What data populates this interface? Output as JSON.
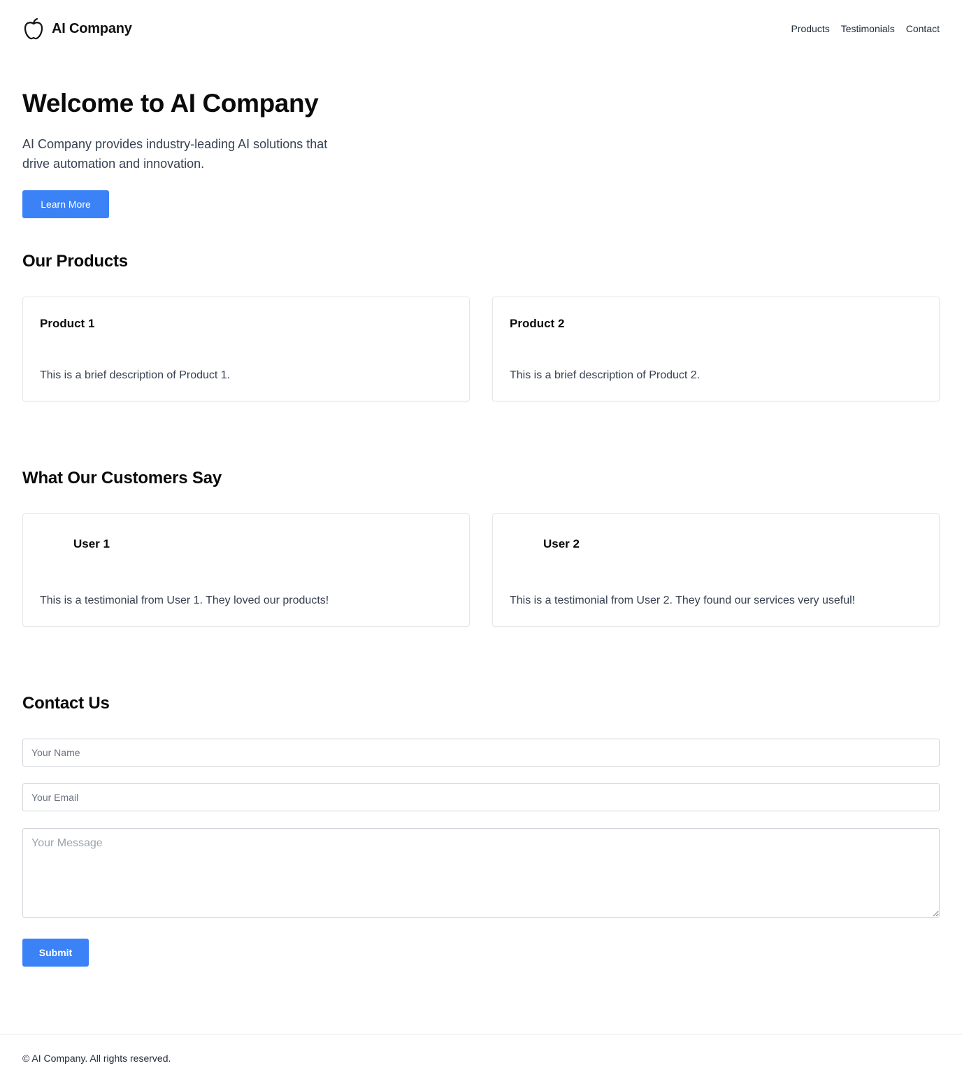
{
  "header": {
    "logo_icon": "apple-icon",
    "brand": "AI Company",
    "nav": [
      "Products",
      "Testimonials",
      "Contact"
    ]
  },
  "hero": {
    "title": "Welcome to AI Company",
    "subtitle": "AI Company provides industry-leading AI solutions that drive automation and innovation.",
    "button": "Learn More"
  },
  "products": {
    "title": "Our Products",
    "items": [
      {
        "name": "Product 1",
        "description": "This is a brief description of Product 1."
      },
      {
        "name": "Product 2",
        "description": "This is a brief description of Product 2."
      }
    ]
  },
  "testimonials": {
    "title": "What Our Customers Say",
    "items": [
      {
        "user": "User 1",
        "text": "This is a testimonial from User 1. They loved our products!"
      },
      {
        "user": "User 2",
        "text": "This is a testimonial from User 2. They found our services very useful!"
      }
    ]
  },
  "contact": {
    "title": "Contact Us",
    "name_placeholder": "Your Name",
    "email_placeholder": "Your Email",
    "message_placeholder": "Your Message",
    "submit": "Submit"
  },
  "footer": {
    "text": "© AI Company. All rights reserved."
  },
  "colors": {
    "accent": "#3b82f6",
    "border": "#e5e7eb"
  }
}
